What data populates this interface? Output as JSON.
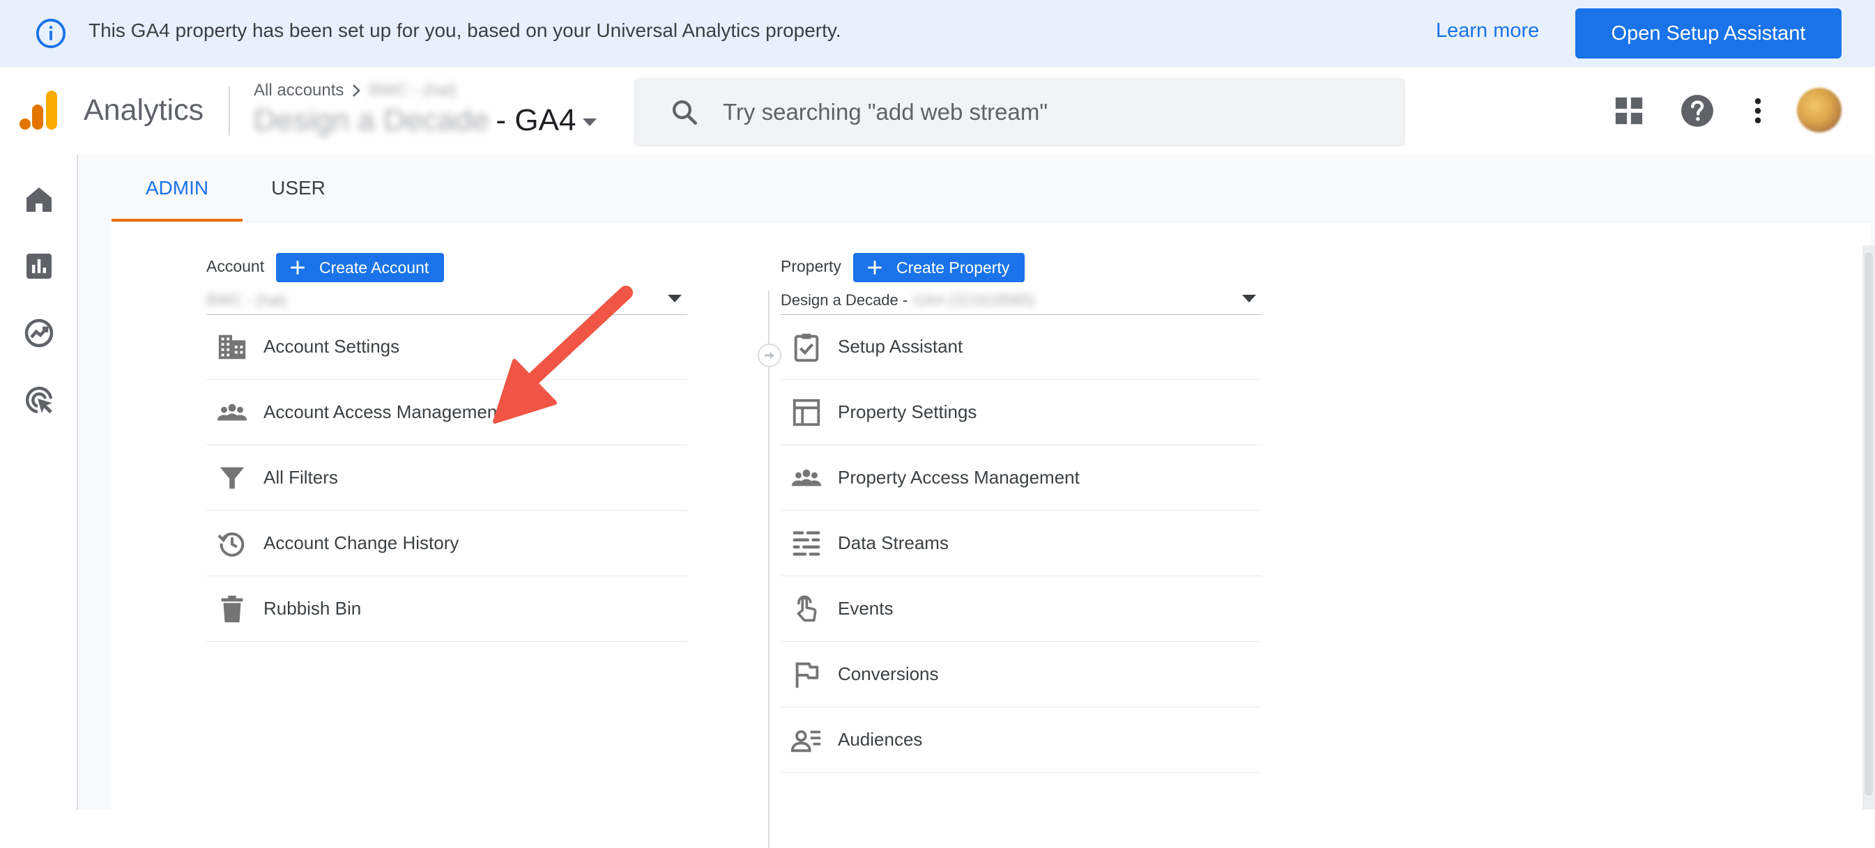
{
  "banner": {
    "icon": "info-icon",
    "message": "This GA4 property has been set up for you, based on your Universal Analytics property.",
    "learn_more": "Learn more",
    "open_setup": "Open Setup Assistant"
  },
  "header": {
    "product_name": "Analytics",
    "breadcrumb_root": "All accounts",
    "breadcrumb_account": "BWC - (hal)",
    "property_name": "Design a Decade",
    "property_suffix": "- GA4",
    "search_placeholder": "Try searching \"add web stream\""
  },
  "rail": {
    "items": [
      "home-icon",
      "reports-icon",
      "explore-icon",
      "advertising-icon"
    ]
  },
  "tabs": [
    {
      "label": "ADMIN",
      "active": true
    },
    {
      "label": "USER",
      "active": false
    }
  ],
  "account": {
    "label": "Account",
    "create_button": "Create Account",
    "selected": "BWC - (hal)",
    "items": [
      {
        "label": "Account Settings",
        "icon": "building-icon"
      },
      {
        "label": "Account Access Management",
        "icon": "people-icon"
      },
      {
        "label": "All Filters",
        "icon": "filter-icon"
      },
      {
        "label": "Account Change History",
        "icon": "history-icon"
      },
      {
        "label": "Rubbish Bin",
        "icon": "trash-icon"
      }
    ]
  },
  "property": {
    "label": "Property",
    "create_button": "Create Property",
    "selected_prefix": "Design a Decade -",
    "selected_rest": "GA4 (321618565)",
    "items": [
      {
        "label": "Setup Assistant",
        "icon": "checklist-icon"
      },
      {
        "label": "Property Settings",
        "icon": "layout-icon"
      },
      {
        "label": "Property Access Management",
        "icon": "people-icon"
      },
      {
        "label": "Data Streams",
        "icon": "streams-icon"
      },
      {
        "label": "Events",
        "icon": "touch-icon"
      },
      {
        "label": "Conversions",
        "icon": "flag-icon"
      },
      {
        "label": "Audiences",
        "icon": "audience-icon"
      }
    ]
  },
  "colors": {
    "accent": "#1a73e8",
    "tab_indicator": "#e8710a",
    "annotation_arrow": "#f05545",
    "banner_bg": "#e8f0fe"
  }
}
